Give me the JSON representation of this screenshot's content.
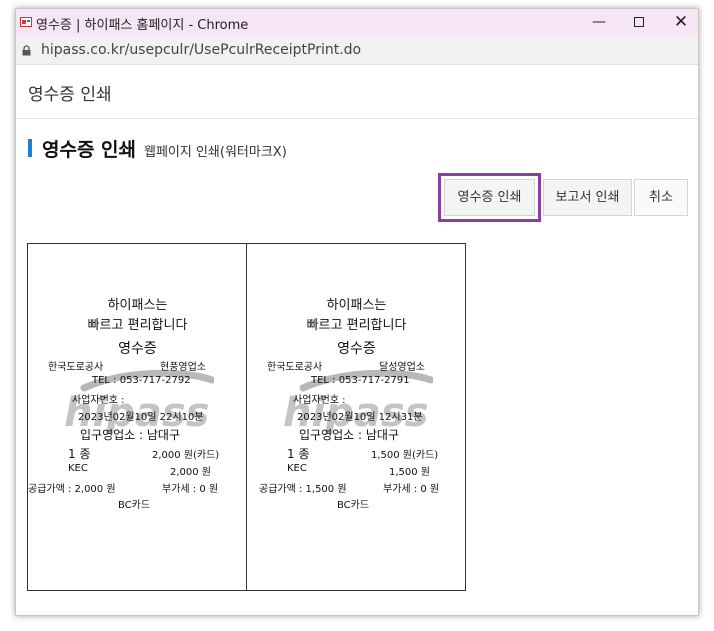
{
  "window": {
    "title": "영수증 | 하이패스 홈페이지 - Chrome",
    "url": "hipass.co.kr/usepculr/UsePculrReceiptPrint.do",
    "controls": {
      "minimize": "—",
      "close": "✕"
    }
  },
  "page": {
    "header": "영수증 인쇄",
    "section_title": "영수증 인쇄",
    "section_subtitle": "웹페이지 인쇄(워터마크X)"
  },
  "buttons": {
    "print_receipt": "영수증 인쇄",
    "print_report": "보고서 인쇄",
    "cancel": "취소"
  },
  "receipts": [
    {
      "line1": "하이패스는",
      "line2": "빠르고 편리합니다",
      "heading": "영수증",
      "company": "한국도로공사",
      "office": "현풍영업소",
      "tel": "TEL : 053-717-2792",
      "bizno": "사업자번호 :",
      "datetime": "2023년02월10일 22시10분",
      "entry": "입구영업소 : 남대구",
      "class": "1 종",
      "amount_card": "2,000 원(카드)",
      "kec": "KEC",
      "kec_amount": "2,000 원",
      "supply": "공급가액 : 2,000 원",
      "vat": "부가세 : 0 원",
      "card": "BC카드",
      "watermark": "hipass"
    },
    {
      "line1": "하이패스는",
      "line2": "빠르고 편리합니다",
      "heading": "영수증",
      "company": "한국도로공사",
      "office": "달성영업소",
      "tel": "TEL : 053-717-2791",
      "bizno": "사업자번호 :",
      "datetime": "2023년02월10일 12시31분",
      "entry": "입구영업소 : 남대구",
      "class": "1 종",
      "amount_card": "1,500 원(카드)",
      "kec": "KEC",
      "kec_amount": "1,500 원",
      "supply": "공급가액 : 1,500 원",
      "vat": "부가세 : 0 원",
      "card": "BC카드",
      "watermark": "hipass"
    }
  ]
}
